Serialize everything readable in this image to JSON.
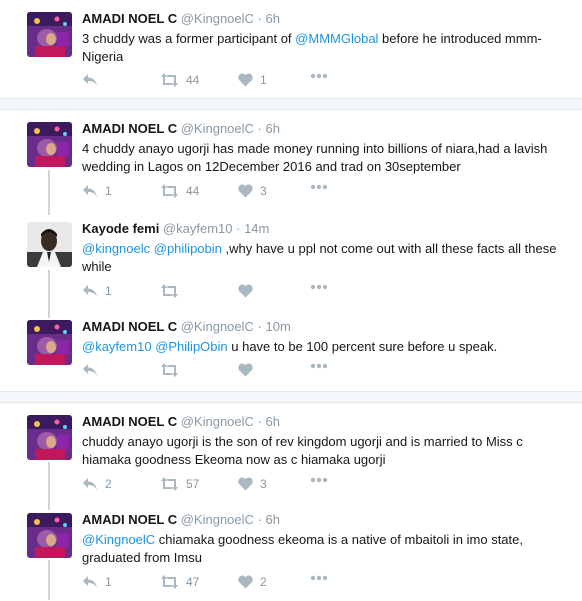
{
  "colors": {
    "mention": "#1b95e0",
    "muted": "#8899a6",
    "icon": "#aab8c2",
    "separator": "#f5f8fa"
  },
  "tweets": [
    {
      "name": "AMADI NOEL C",
      "handle": "@KingnoelC",
      "dot": "·",
      "time": "6h",
      "text_parts": [
        {
          "text": "3 chuddy was a former participant of ",
          "mention": false
        },
        {
          "text": "@MMMGlobal",
          "mention": true
        },
        {
          "text": " before he introduced mmm-Nigeria",
          "mention": false
        }
      ],
      "reply_count": "",
      "retweet_count": "44",
      "like_count": "1"
    },
    {
      "name": "AMADI NOEL C",
      "handle": "@KingnoelC",
      "dot": "·",
      "time": "6h",
      "text_parts": [
        {
          "text": "4 chuddy anayo ugorji has made money running into billions of niara,had a lavish wedding in Lagos on 12December 2016 and trad on 30september",
          "mention": false
        }
      ],
      "reply_count": "1",
      "retweet_count": "44",
      "like_count": "3"
    },
    {
      "name": "Kayode femi",
      "handle": "@kayfem10",
      "dot": "·",
      "time": "14m",
      "text_parts": [
        {
          "text": "@kingnoelc",
          "mention": true
        },
        {
          "text": " ",
          "mention": false
        },
        {
          "text": "@philipobin",
          "mention": true
        },
        {
          "text": " ,why have u ppl not come out with all these facts all these while",
          "mention": false
        }
      ],
      "reply_count": "1",
      "retweet_count": "",
      "like_count": ""
    },
    {
      "name": "AMADI NOEL C",
      "handle": "@KingnoelC",
      "dot": "·",
      "time": "10m",
      "text_parts": [
        {
          "text": "@kayfem10",
          "mention": true
        },
        {
          "text": " ",
          "mention": false
        },
        {
          "text": "@PhilipObin",
          "mention": true
        },
        {
          "text": " u have to be 100 percent sure before u speak.",
          "mention": false
        }
      ],
      "reply_count": "",
      "retweet_count": "",
      "like_count": ""
    },
    {
      "name": "AMADI NOEL C",
      "handle": "@KingnoelC",
      "dot": "·",
      "time": "6h",
      "text_parts": [
        {
          "text": "chuddy anayo ugorji is the son of rev kingdom ugorji  and is married to Miss c hiamaka goodness Ekeoma  now as c hiamaka ugorji",
          "mention": false
        }
      ],
      "reply_count": "2",
      "retweet_count": "57",
      "like_count": "3"
    },
    {
      "name": "AMADI NOEL C",
      "handle": "@KingnoelC",
      "dot": "·",
      "time": "6h",
      "text_parts": [
        {
          "text": "@KingnoelC",
          "mention": true
        },
        {
          "text": " chiamaka  goodness ekeoma is a native of mbaitoli in imo state, graduated from Imsu",
          "mention": false
        }
      ],
      "reply_count": "1",
      "retweet_count": "47",
      "like_count": "2"
    }
  ]
}
